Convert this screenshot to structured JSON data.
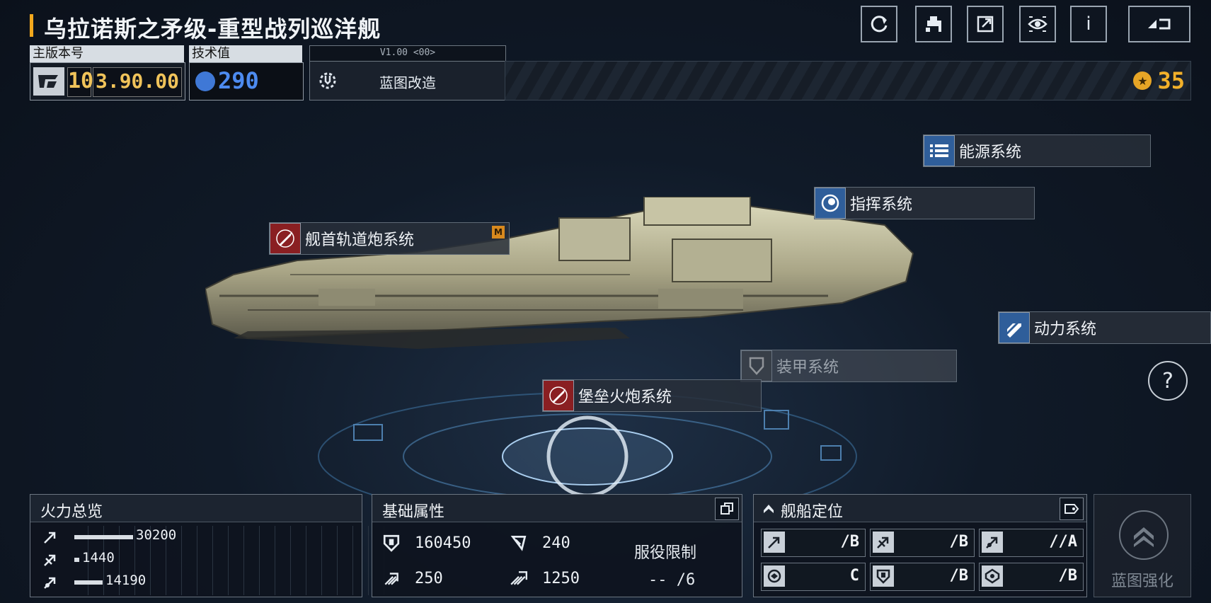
{
  "title": "乌拉诺斯之矛级-重型战列巡洋舰",
  "toolbar": {
    "buttons": [
      {
        "icon": "refresh-icon"
      },
      {
        "icon": "paint-icon"
      },
      {
        "icon": "share-icon"
      },
      {
        "icon": "eye-icon"
      },
      {
        "icon": "info-icon",
        "glyph": "i"
      },
      {
        "icon": "back-icon"
      }
    ]
  },
  "version": {
    "label": "主版本号",
    "major": "10",
    "minor": "3.90.00"
  },
  "tech": {
    "label": "技术值",
    "value": "290"
  },
  "blueprint": {
    "version_tag": "V1.00 <00>",
    "mod_label": "蓝图改造"
  },
  "credits": {
    "value": "35"
  },
  "systems": {
    "energy": "能源系统",
    "command": "指挥系统",
    "bow_railgun": "舰首轨道炮系统",
    "bow_railgun_tag": "M",
    "power": "动力系统",
    "armor": "装甲系统",
    "fortress_cannon": "堡垒火炮系统"
  },
  "help_glyph": "?",
  "firepower": {
    "title": "火力总览",
    "rows": [
      {
        "icon": "anti-ship-icon",
        "value": "30200",
        "fraction": 0.25
      },
      {
        "icon": "anti-aircraft-icon",
        "value": "1440",
        "fraction": 0.02
      },
      {
        "icon": "siege-icon",
        "value": "14190",
        "fraction": 0.12
      }
    ]
  },
  "base_stats": {
    "title": "基础属性",
    "hp": "160450",
    "armor_val": "240",
    "speed": "250",
    "warp_speed": "1250",
    "service_label": "服役限制",
    "service_value": "--  /6"
  },
  "positioning": {
    "title": "舰船定位",
    "grades": [
      {
        "icon": "anti-ship-icon",
        "grade": "/B"
      },
      {
        "icon": "anti-aircraft-icon",
        "grade": "/B"
      },
      {
        "icon": "siege-icon",
        "grade": "//A"
      },
      {
        "icon": "support-icon",
        "grade": "C"
      },
      {
        "icon": "defense-icon",
        "grade": "/B"
      },
      {
        "icon": "tank-icon",
        "grade": "/B"
      }
    ]
  },
  "enhance": {
    "label": "蓝图强化"
  }
}
